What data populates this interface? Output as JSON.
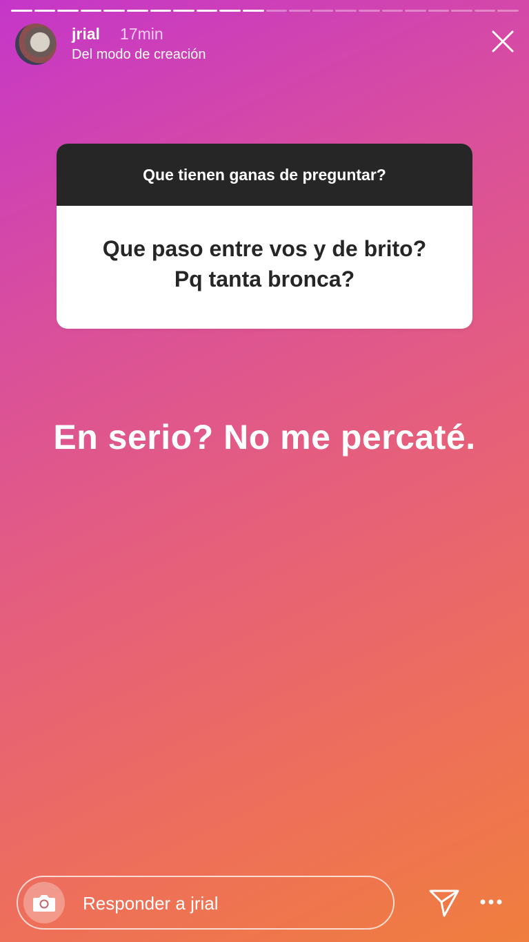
{
  "story": {
    "user_name": "jrial",
    "time_ago": "17min",
    "subtitle": "Del modo de creación",
    "progress_segments": 22,
    "progress_completed": 11
  },
  "question_card": {
    "prompt": "Que tienen ganas de preguntar?",
    "answer_line1": "Que paso entre vos y de brito?",
    "answer_line2": "Pq tanta bronca?"
  },
  "main_text": "En serio? No me percaté.",
  "footer": {
    "reply_placeholder": "Responder a jrial"
  },
  "icons": {
    "close": "close-icon",
    "camera": "camera-icon",
    "send": "send-icon",
    "more": "more-options-icon"
  },
  "colors": {
    "gradient_top": "#c536c9",
    "gradient_mid": "#e6607a",
    "gradient_bottom": "#f07e3e",
    "card_header": "#262626",
    "card_body": "#ffffff"
  }
}
